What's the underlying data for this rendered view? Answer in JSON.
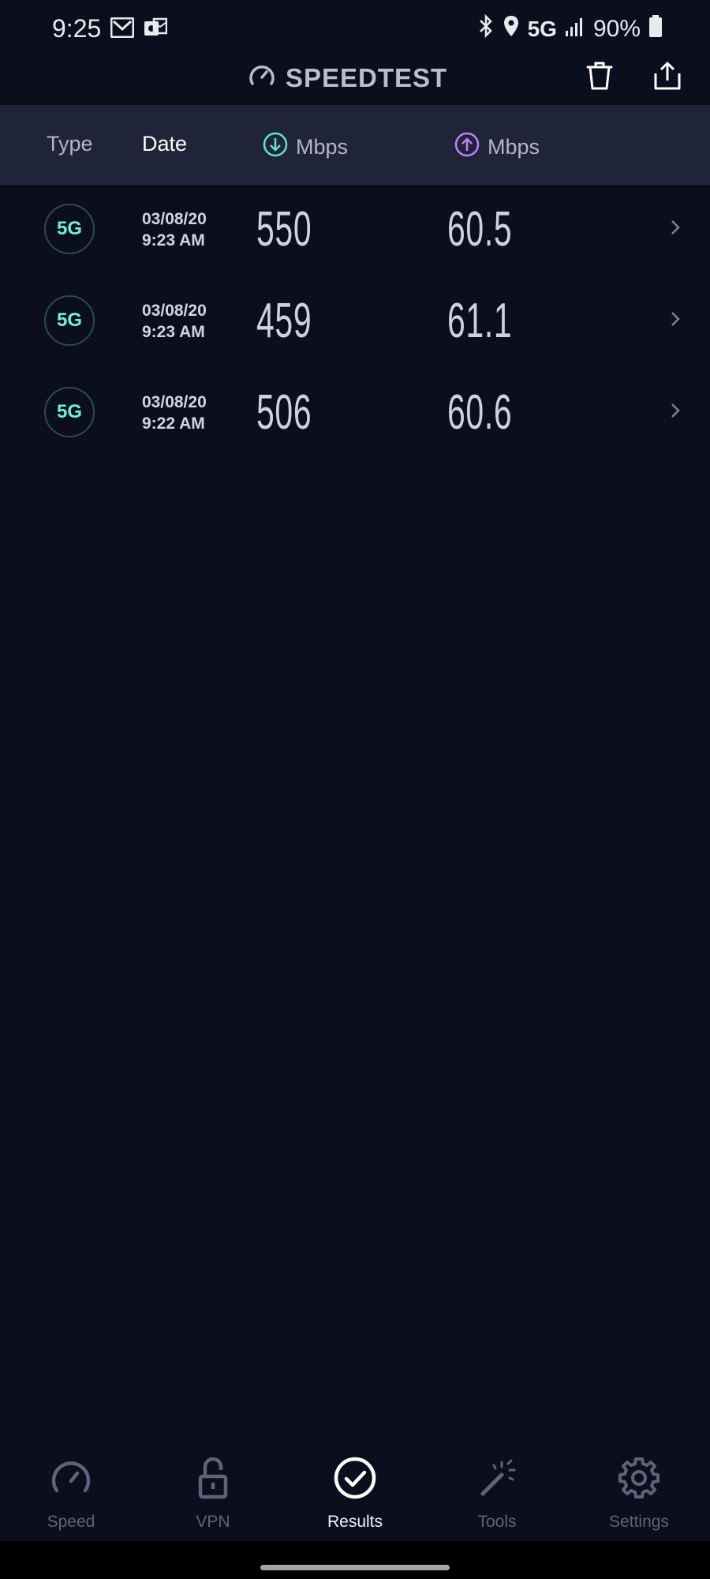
{
  "status_bar": {
    "time": "9:25",
    "network": "5G",
    "battery": "90%",
    "icons": [
      "gmail-icon",
      "outlook-icon",
      "bluetooth-icon",
      "location-icon",
      "signal-icon",
      "battery-icon"
    ]
  },
  "header": {
    "title": "SPEEDTEST",
    "icons": [
      "speedometer-icon",
      "trash-icon",
      "share-icon"
    ]
  },
  "columns": {
    "type": "Type",
    "date": "Date",
    "download": "Mbps",
    "upload": "Mbps"
  },
  "results": [
    {
      "type": "5G",
      "date": "03/08/20",
      "time": "9:23 AM",
      "download": "550",
      "upload": "60.5"
    },
    {
      "type": "5G",
      "date": "03/08/20",
      "time": "9:23 AM",
      "download": "459",
      "upload": "61.1"
    },
    {
      "type": "5G",
      "date": "03/08/20",
      "time": "9:22 AM",
      "download": "506",
      "upload": "60.6"
    }
  ],
  "nav": {
    "items": [
      {
        "label": "Speed",
        "icon": "speedometer-icon"
      },
      {
        "label": "VPN",
        "icon": "unlock-icon"
      },
      {
        "label": "Results",
        "icon": "check-circle-icon"
      },
      {
        "label": "Tools",
        "icon": "magic-wand-icon"
      },
      {
        "label": "Settings",
        "icon": "gear-icon"
      }
    ],
    "active": "Results"
  },
  "colors": {
    "background": "#0b0e1c",
    "header_bar": "#1f2438",
    "download_accent": "#5fe3d3",
    "upload_accent": "#c77dff",
    "badge_text": "#6ff0dc"
  }
}
